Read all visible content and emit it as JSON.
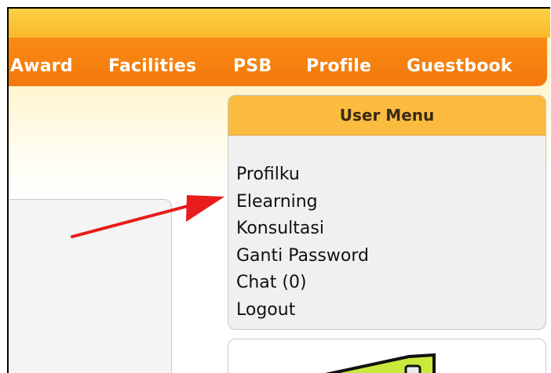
{
  "nav": {
    "items": [
      "Award",
      "Facilities",
      "PSB",
      "Profile",
      "Guestbook"
    ]
  },
  "user_menu": {
    "title": "User Menu",
    "items": [
      "Profilku",
      "Elearning",
      "Konsultasi",
      "Ganti Password",
      "Chat (0)",
      "Logout"
    ]
  },
  "annotation": {
    "arrow_color": "#e81c1c",
    "points_to": "Elearning"
  },
  "colors": {
    "nav_orange": "#f7820f",
    "top_band": "#fbc43a",
    "menu_header": "#fbbb3f",
    "banner_green": "#c8ea3c"
  }
}
